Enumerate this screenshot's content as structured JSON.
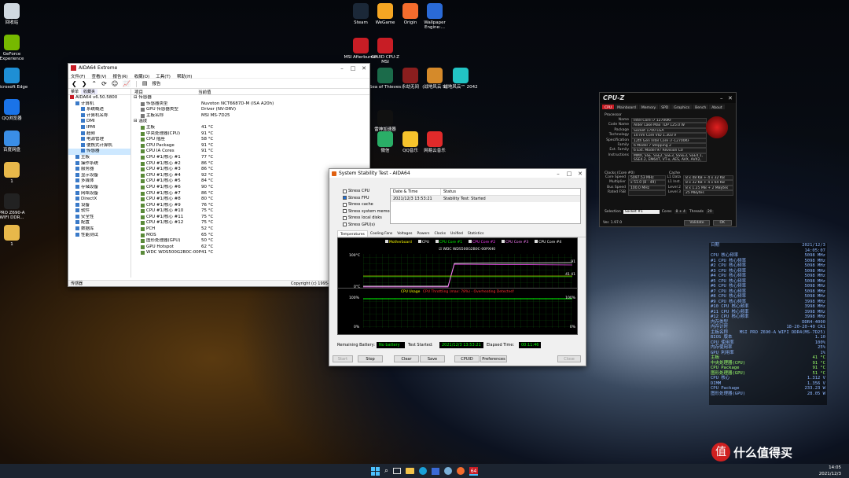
{
  "desktop": {
    "left_icons": [
      {
        "label": "回收站",
        "color": "#cfd8e0"
      },
      {
        "label": "GeForce Experience",
        "color": "#76b900"
      },
      {
        "label": "Microsoft Edge",
        "color": "#1e8fd5"
      },
      {
        "label": "QQ浏览器",
        "color": "#1a73e8"
      },
      {
        "label": "百度网盘",
        "color": "#3a8ee6"
      },
      {
        "label": "1",
        "color": "#e8b84a"
      },
      {
        "label": "PRO Z690-A WIFI DDR...",
        "color": "#222"
      },
      {
        "label": "1",
        "color": "#e8b84a"
      }
    ],
    "top_icons": [
      {
        "label": "Steam",
        "color": "#1b2838"
      },
      {
        "label": "WeGame",
        "color": "#f5a623"
      },
      {
        "label": "Origin",
        "color": "#f56c2d"
      },
      {
        "label": "Wallpaper Engine:...",
        "color": "#2a6ad6"
      },
      {
        "label": "MSI Afterburner",
        "color": "#c81d25"
      },
      {
        "label": "CPUID CPU-Z MSI",
        "color": "#c81d25"
      },
      {
        "label": "Sea of Thieves",
        "color": "#1b6b4a"
      },
      {
        "label": "永劫无间",
        "color": "#8a1e1e"
      },
      {
        "label": "(战地风云 5)",
        "color": "#d58a2a"
      },
      {
        "label": "战地风云™ 2042",
        "color": "#22c4c4"
      },
      {
        "label": "雷神加速器",
        "color": "#111"
      },
      {
        "label": "微信",
        "color": "#2aae67"
      },
      {
        "label": "QQ音乐",
        "color": "#f6c32c"
      },
      {
        "label": "网易云音乐",
        "color": "#e02a2a"
      }
    ]
  },
  "aida": {
    "title": "AIDA64 Extreme",
    "menu": [
      "文件(F)",
      "查看(V)",
      "报告(R)",
      "收藏(O)",
      "工具(T)",
      "帮助(H)"
    ],
    "toolbar_label": "报告",
    "tabs": [
      "菜单",
      "收藏夹"
    ],
    "tree": [
      {
        "label": "AIDA64 v6.50.5800",
        "indent": 0
      },
      {
        "label": "计算机",
        "indent": 1
      },
      {
        "label": "系统概述",
        "indent": 2
      },
      {
        "label": "计算机名称",
        "indent": 2
      },
      {
        "label": "DMI",
        "indent": 2
      },
      {
        "label": "IPMI",
        "indent": 2
      },
      {
        "label": "超频",
        "indent": 2
      },
      {
        "label": "电源管理",
        "indent": 2
      },
      {
        "label": "便携式计算机",
        "indent": 2
      },
      {
        "label": "传感器",
        "indent": 2
      },
      {
        "label": "主板",
        "indent": 1
      },
      {
        "label": "操作系统",
        "indent": 1
      },
      {
        "label": "服务器",
        "indent": 1
      },
      {
        "label": "显示设备",
        "indent": 1
      },
      {
        "label": "多媒体",
        "indent": 1
      },
      {
        "label": "存储设备",
        "indent": 1
      },
      {
        "label": "网络设备",
        "indent": 1
      },
      {
        "label": "DirectX",
        "indent": 1
      },
      {
        "label": "设备",
        "indent": 1
      },
      {
        "label": "软件",
        "indent": 1
      },
      {
        "label": "安全性",
        "indent": 1
      },
      {
        "label": "配置",
        "indent": 1
      },
      {
        "label": "数据库",
        "indent": 1
      },
      {
        "label": "性能测试",
        "indent": 1
      }
    ],
    "headers": [
      "项目",
      "当前值"
    ],
    "sensors_group": "传感器",
    "sensors": [
      {
        "name": "传感器类型",
        "value": "Nuvoton NCT6687D-M (ISA A20h)"
      },
      {
        "name": "GPU 传感器类型",
        "value": "Driver (NV-DRV)"
      },
      {
        "name": "主板名称",
        "value": "MSI MS-7D25"
      }
    ],
    "temp_group": "温度",
    "temps": [
      {
        "name": "主板",
        "value": "41 °C"
      },
      {
        "name": "中央处理器(CPU)",
        "value": "91 °C"
      },
      {
        "name": "CPU 插座",
        "value": "58 °C"
      },
      {
        "name": "CPU Package",
        "value": "91 °C"
      },
      {
        "name": "CPU IA Cores",
        "value": "91 °C"
      },
      {
        "name": "CPU #1/核心 #1",
        "value": "77 °C"
      },
      {
        "name": "CPU #1/核心 #2",
        "value": "86 °C"
      },
      {
        "name": "CPU #1/核心 #3",
        "value": "86 °C"
      },
      {
        "name": "CPU #1/核心 #4",
        "value": "92 °C"
      },
      {
        "name": "CPU #1/核心 #5",
        "value": "84 °C"
      },
      {
        "name": "CPU #1/核心 #6",
        "value": "90 °C"
      },
      {
        "name": "CPU #1/核心 #7",
        "value": "86 °C"
      },
      {
        "name": "CPU #1/核心 #8",
        "value": "80 °C"
      },
      {
        "name": "CPU #1/核心 #9",
        "value": "76 °C"
      },
      {
        "name": "CPU #1/核心 #10",
        "value": "75 °C"
      },
      {
        "name": "CPU #1/核心 #11",
        "value": "75 °C"
      },
      {
        "name": "CPU #1/核心 #12",
        "value": "75 °C"
      },
      {
        "name": "PCH",
        "value": "52 °C"
      },
      {
        "name": "MOS",
        "value": "65 °C"
      },
      {
        "name": "图形处理器(GPU)",
        "value": "50 °C"
      },
      {
        "name": "GPU Hotspot",
        "value": "62 °C"
      },
      {
        "name": "WDC WDS500G2B0C-00PXH0",
        "value": "41 °C"
      }
    ],
    "status_left": "传感器",
    "status_right": "Copyright (c) 1995-2021 FinalWire Ltd."
  },
  "stability": {
    "title": "System Stability Test - AIDA64",
    "checks": [
      {
        "label": "Stress CPU",
        "checked": false
      },
      {
        "label": "Stress FPU",
        "checked": true
      },
      {
        "label": "Stress cache",
        "checked": false
      },
      {
        "label": "Stress system memory",
        "checked": false
      },
      {
        "label": "Stress local disks",
        "checked": false
      },
      {
        "label": "Stress GPU(s)",
        "checked": false
      }
    ],
    "log_headers": [
      "Date & Time",
      "Status"
    ],
    "log_date": "2021/12/3 13:53:21",
    "log_status": "Stability Test: Started",
    "tabs": [
      "Temperatures",
      "Cooling Fans",
      "Voltages",
      "Powers",
      "Clocks",
      "Unified",
      "Statistics"
    ],
    "legend": [
      {
        "label": "Motherboard",
        "color": "#ffff00"
      },
      {
        "label": "CPU",
        "color": "#ffffff"
      },
      {
        "label": "CPU Core #1",
        "color": "#00ff00"
      },
      {
        "label": "CPU Core #2",
        "color": "#ff40ff"
      },
      {
        "label": "CPU Core #3",
        "color": "#ff80ff"
      },
      {
        "label": "CPU Core #4",
        "color": "#ffffff"
      }
    ],
    "legend2": "WDC WDS500G2B0C-00PXH0",
    "temp_top": "100°C",
    "temp_bottom": "0°C",
    "temp_time": "13:53:21",
    "temp_r1": "91",
    "temp_r2": "41 41",
    "cpu_title": "CPU Usage",
    "cpu_throttle": "CPU Throttling (max: 78%) - Overheating Detected!",
    "cpu_top": "100%",
    "cpu_bottom": "0%",
    "cpu_top_r": "100%",
    "cpu_bottom_r": "0%",
    "battery_label": "Remaining Battery:",
    "battery_value": "No battery",
    "started_label": "Test Started:",
    "started_value": "2021/12/3 13:53:21",
    "elapsed_label": "Elapsed Time:",
    "elapsed_value": "00:11:46",
    "buttons": [
      "Start",
      "Stop",
      "Clear",
      "Save",
      "CPUID",
      "Preferences",
      "Close"
    ]
  },
  "cpuz": {
    "logo": "CPU-Z",
    "tabs": [
      "CPU",
      "Mainboard",
      "Memory",
      "SPD",
      "Graphics",
      "Bench",
      "About"
    ],
    "section_processor": "Processor",
    "rows": [
      {
        "k": "Name",
        "v": "Intel Core i7 12700KF"
      },
      {
        "k": "Code Name",
        "v": "Alder Lake   Max TDP   125.0 W"
      },
      {
        "k": "Package",
        "v": "Socket 1700 LGA"
      },
      {
        "k": "Technology",
        "v": "10 nm    Core VID    1.303 V"
      },
      {
        "k": "Specification",
        "v": "12th Gen Intel Core i7-12700KF"
      },
      {
        "k": "Family",
        "v": "6    Model  7    Stepping  2"
      },
      {
        "k": "Ext. Family",
        "v": "6    Ext. Model  97    Revision  C0"
      },
      {
        "k": "Instructions",
        "v": "MMX, SSE, SSE2, SSE3, SSSE3, SSE4.1, SSE4.2, EM64T, VT-x, AES, AVX, AVX2, FMA3, SHA"
      }
    ],
    "section_clocks": "Clocks (Core #0)",
    "section_cache": "Cache",
    "clocks": [
      {
        "k": "Core Speed",
        "v": "5097.53 MHz",
        "ck": "L1 Data",
        "cv": "8 x 48 KB + 4 x 32 KB"
      },
      {
        "k": "Multiplier",
        "v": "x 51.0 (8 - 49)",
        "ck": "L1 Inst.",
        "cv": "8 x 32 KB + 4 x 64 KB"
      },
      {
        "k": "Bus Speed",
        "v": "100.0 MHz",
        "ck": "Level 2",
        "cv": "8 x 1.25 MB + 2 MBytes"
      },
      {
        "k": "Rated FSB",
        "v": "",
        "ck": "Level 3",
        "cv": "25 MBytes"
      }
    ],
    "selection_label": "Selection",
    "selection_value": "Socket #1",
    "cores_label": "Cores",
    "cores_value": "8 + 4",
    "threads_label": "Threads",
    "threads_value": "20",
    "version": "Ver. 1.97.0",
    "validate": "Validate",
    "ok": "OK"
  },
  "overlay": {
    "rows": [
      {
        "k": "日期",
        "v": "2021/12/3",
        "c": "#8fb8ff"
      },
      {
        "k": "",
        "v": "14:05:07",
        "c": "#8fb8ff"
      },
      {
        "k": "CPU 核心频率",
        "v": "5098 MHz",
        "c": "#8fb8ff"
      },
      {
        "k": "#1 CPU 核心频率",
        "v": "5098 MHz",
        "c": "#8fb8ff"
      },
      {
        "k": "#2 CPU 核心频率",
        "v": "5098 MHz",
        "c": "#8fb8ff"
      },
      {
        "k": "#3 CPU 核心频率",
        "v": "5098 MHz",
        "c": "#8fb8ff"
      },
      {
        "k": "#4 CPU 核心频率",
        "v": "5098 MHz",
        "c": "#8fb8ff"
      },
      {
        "k": "#5 CPU 核心频率",
        "v": "5098 MHz",
        "c": "#8fb8ff"
      },
      {
        "k": "#6 CPU 核心频率",
        "v": "5098 MHz",
        "c": "#8fb8ff"
      },
      {
        "k": "#7 CPU 核心频率",
        "v": "5098 MHz",
        "c": "#8fb8ff"
      },
      {
        "k": "#8 CPU 核心频率",
        "v": "5098 MHz",
        "c": "#8fb8ff"
      },
      {
        "k": "#9 CPU 核心频率",
        "v": "3998 MHz",
        "c": "#8fb8ff"
      },
      {
        "k": "#10 CPU 核心频率",
        "v": "3998 MHz",
        "c": "#8fb8ff"
      },
      {
        "k": "#11 CPU 核心频率",
        "v": "3998 MHz",
        "c": "#8fb8ff"
      },
      {
        "k": "#12 CPU 核心频率",
        "v": "3998 MHz",
        "c": "#8fb8ff"
      },
      {
        "k": "内存类型",
        "v": "DDR4-4000",
        "c": "#8fb8ff"
      },
      {
        "k": "内存计时",
        "v": "18-20-20-40 CR1",
        "c": "#8fb8ff"
      },
      {
        "k": "主板名称",
        "v": "MSI PRO Z690-A WIFI DDR4(MS-7D25)",
        "c": "#8fb8ff"
      },
      {
        "k": "BIOS 版本",
        "v": "1.10",
        "c": "#8fb8ff"
      },
      {
        "k": "CPU 使用率",
        "v": "100%",
        "c": "#8fb8ff"
      },
      {
        "k": "内存使用率",
        "v": "25%",
        "c": "#8fb8ff"
      },
      {
        "k": "GPU 利用率",
        "v": "1%",
        "c": "#8fb8ff"
      },
      {
        "k": "主板",
        "v": "41 °C",
        "c": "#9aff6a"
      },
      {
        "k": "中央处理器(CPU)",
        "v": "91 °C",
        "c": "#9aff6a"
      },
      {
        "k": "CPU Package",
        "v": "91 °C",
        "c": "#9aff6a"
      },
      {
        "k": "图形处理器(GPU)",
        "v": "51 °C",
        "c": "#9aff6a"
      },
      {
        "k": "CPU 核心",
        "v": "1.312 V",
        "c": "#8fb8ff"
      },
      {
        "k": "DIMM",
        "v": "1.356 V",
        "c": "#8fb8ff"
      },
      {
        "k": "CPU Package",
        "v": "233.23 W",
        "c": "#8fb8ff"
      },
      {
        "k": "图形处理器(GPU)",
        "v": "28.05 W",
        "c": "#8fb8ff"
      }
    ]
  },
  "taskbar": {
    "clock_time": "14:05",
    "clock_date": "2021/12/3",
    "app_label": "64",
    "watermark": "什么值得买"
  }
}
